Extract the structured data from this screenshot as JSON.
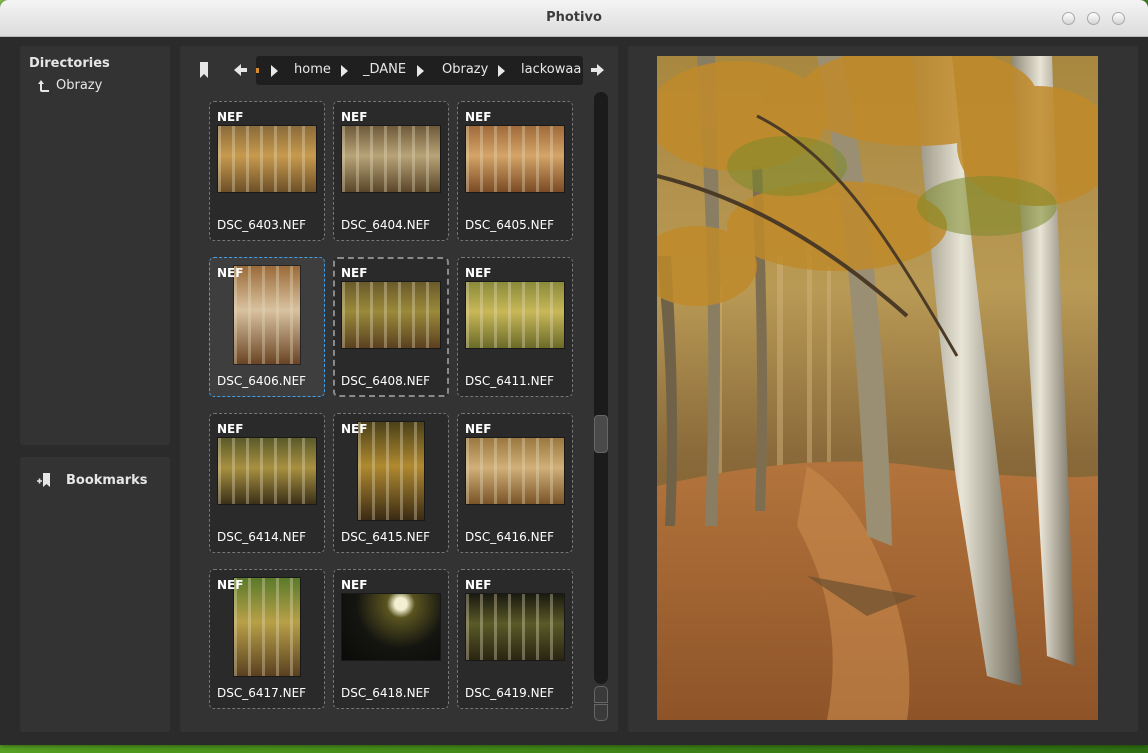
{
  "window": {
    "title": "Photivo"
  },
  "directories": {
    "title": "Directories",
    "item": "Obrazy"
  },
  "bookmarks": {
    "title": "Bookmarks"
  },
  "breadcrumb": {
    "items": [
      "home",
      "_DANE",
      "Obrazy",
      "lackowaa"
    ]
  },
  "thumbnails": [
    {
      "format": "NEF",
      "name": "DSC_6403.NEF"
    },
    {
      "format": "NEF",
      "name": "DSC_6404.NEF"
    },
    {
      "format": "NEF",
      "name": "DSC_6405.NEF"
    },
    {
      "format": "NEF",
      "name": "DSC_6406.NEF"
    },
    {
      "format": "NEF",
      "name": "DSC_6408.NEF"
    },
    {
      "format": "NEF",
      "name": "DSC_6411.NEF"
    },
    {
      "format": "NEF",
      "name": "DSC_6414.NEF"
    },
    {
      "format": "NEF",
      "name": "DSC_6415.NEF"
    },
    {
      "format": "NEF",
      "name": "DSC_6416.NEF"
    },
    {
      "format": "NEF",
      "name": "DSC_6417.NEF"
    },
    {
      "format": "NEF",
      "name": "DSC_6418.NEF"
    },
    {
      "format": "NEF",
      "name": "DSC_6419.NEF"
    }
  ],
  "icons": {
    "up": "up-arrow-icon",
    "bookmark_add": "bookmark-add-icon",
    "bookmark_pin": "bookmark-icon",
    "back": "arrow-left-icon",
    "forward": "arrow-right-icon"
  },
  "colors": {
    "selection": "#3f9fe8",
    "panel": "#333333",
    "background": "#2b2b2b"
  }
}
